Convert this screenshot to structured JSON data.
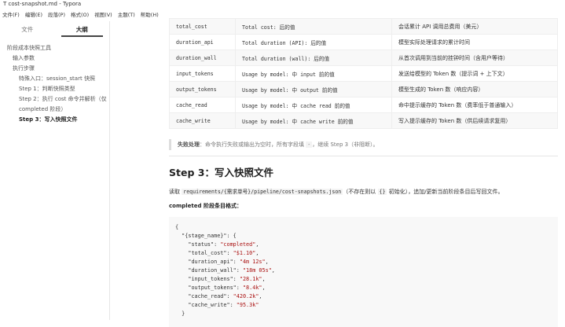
{
  "window": {
    "title": "cost-snapshot.md - Typora",
    "icon": "T"
  },
  "menu": [
    "文件(F)",
    "编辑(E)",
    "段落(P)",
    "格式(O)",
    "视图(V)",
    "主题(T)",
    "帮助(H)"
  ],
  "sidebar": {
    "tabs": [
      "文件",
      "大纲"
    ],
    "outline": [
      {
        "label": "阶段成本快照工具",
        "level": 1
      },
      {
        "label": "输入参数",
        "level": 2
      },
      {
        "label": "执行步骤",
        "level": 2
      },
      {
        "label": "特殊入口：session_start 快照",
        "level": 3
      },
      {
        "label": "Step 1：判断快照类型",
        "level": 3
      },
      {
        "label": "Step 2：执行 cost 命令并解析（仅 completed 阶段）",
        "level": 3
      },
      {
        "label": "Step 3：写入快照文件",
        "level": 3
      }
    ]
  },
  "table": [
    [
      "total_cost",
      "Total cost: 后的值",
      "会话累计 API 调用总费用（美元）"
    ],
    [
      "duration_api",
      "Total duration (API): 后的值",
      "模型实际处理请求的累计时间"
    ],
    [
      "duration_wall",
      "Total duration (wall): 后的值",
      "从首次调用到当前的挂钟时间（含用户等待）"
    ],
    [
      "input_tokens",
      "Usage by model: 中 input 前的值",
      "发送给模型的 Token 数（提示词 + 上下文）"
    ],
    [
      "output_tokens",
      "Usage by model: 中 output 前的值",
      "模型生成的 Token 数（响应内容）"
    ],
    [
      "cache_read",
      "Usage by model: 中 cache read 前的值",
      "命中提示缓存的 Token 数（费率低于普通输入）"
    ],
    [
      "cache_write",
      "Usage by model: 中 cache write 前的值",
      "写入提示缓存的 Token 数（供后续请求复用）"
    ]
  ],
  "quote": {
    "bold": "失败处理",
    "text1": "：命令执行失败或输出为空时，所有字段填 ",
    "code": "-",
    "text2": "，继续 Step 3（非阻断）。"
  },
  "heading": "Step 3：写入快照文件",
  "para": {
    "t1": "读取 ",
    "code1": "requirements/{需求单号}/pipeline/cost-snapshots.json",
    "t2": "（不存在则以 ",
    "code2": "{}",
    "t3": " 初始化），追加/更新当前阶段条目后写回文件。"
  },
  "format_label": "completed 阶段条目格式：",
  "code": {
    "stage_key": "{stage_name}",
    "entries": [
      {
        "k": "status",
        "v": "completed"
      },
      {
        "k": "total_cost",
        "v": "$1.10"
      },
      {
        "k": "duration_api",
        "v": "4m 12s"
      },
      {
        "k": "duration_wall",
        "v": "18m 05s"
      },
      {
        "k": "input_tokens",
        "v": "28.1k"
      },
      {
        "k": "output_tokens",
        "v": "8.4k"
      },
      {
        "k": "cache_read",
        "v": "420.2k"
      },
      {
        "k": "cache_write",
        "v": "95.3k"
      }
    ]
  }
}
